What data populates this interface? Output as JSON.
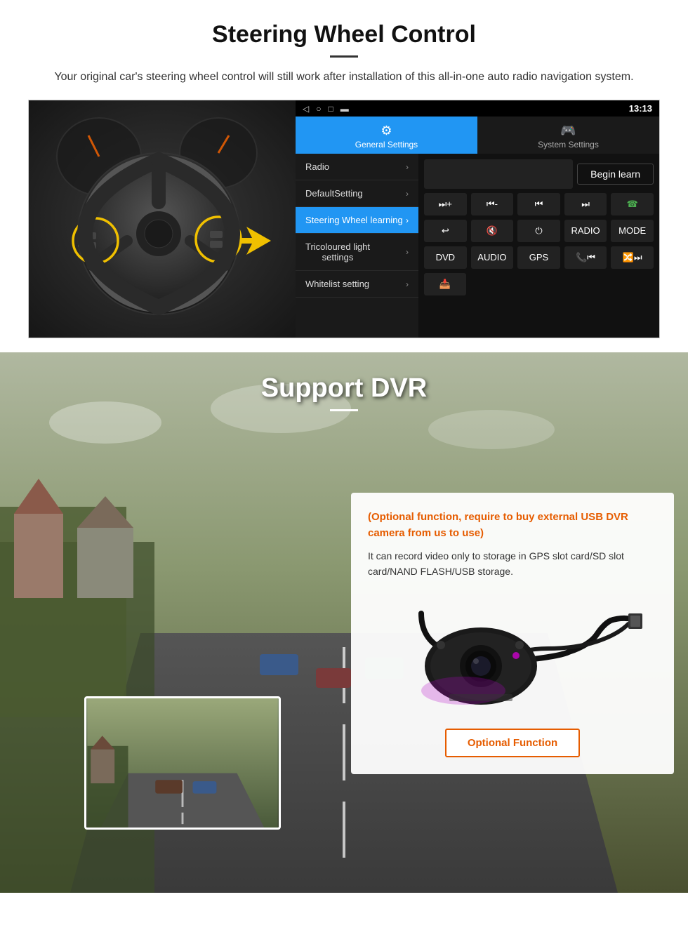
{
  "steering": {
    "section_title": "Steering Wheel Control",
    "subtitle": "Your original car's steering wheel control will still work after installation of this all-in-one auto radio navigation system.",
    "status_bar": {
      "time": "13:13",
      "signal": "▼",
      "wifi": "▾"
    },
    "tabs": [
      {
        "label": "General Settings",
        "active": true
      },
      {
        "label": "System Settings",
        "active": false
      }
    ],
    "menu_items": [
      {
        "label": "Radio",
        "active": false
      },
      {
        "label": "DefaultSetting",
        "active": false
      },
      {
        "label": "Steering Wheel learning",
        "active": true
      },
      {
        "label": "Tricoloured light settings",
        "active": false
      },
      {
        "label": "Whitelist setting",
        "active": false
      }
    ],
    "begin_learn_label": "Begin learn",
    "control_buttons_row1": [
      "⏮+",
      "⏮-",
      "⏮",
      "⏭",
      "☎"
    ],
    "control_buttons_row2": [
      "↩",
      "🔇",
      "⏻",
      "RADIO",
      "MODE"
    ],
    "control_buttons_row3": [
      "DVD",
      "AUDIO",
      "GPS",
      "📞⏮",
      "🔀⏭"
    ],
    "control_buttons_row4": [
      "📥"
    ]
  },
  "dvr": {
    "section_title": "Support DVR",
    "optional_text": "(Optional function, require to buy external USB DVR camera from us to use)",
    "desc_text": "It can record video only to storage in GPS slot card/SD slot card/NAND FLASH/USB storage.",
    "optional_function_label": "Optional Function"
  }
}
